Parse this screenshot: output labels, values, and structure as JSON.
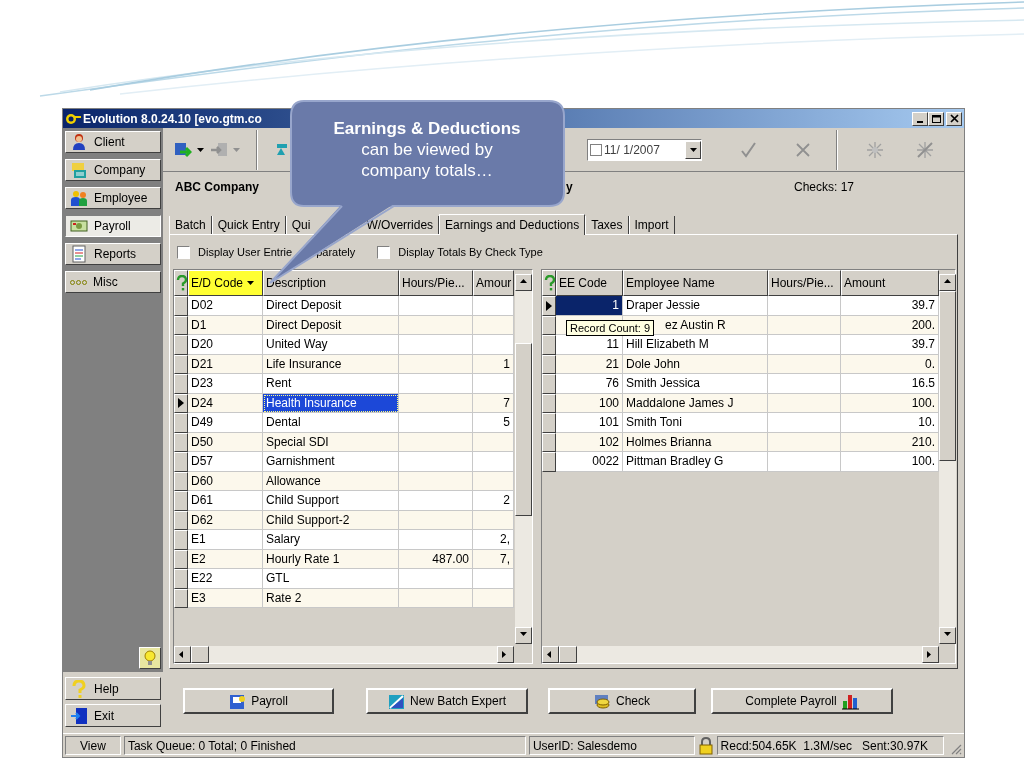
{
  "window": {
    "title": "Evolution 8.0.24.10 [evo.gtm.co"
  },
  "sidebar": {
    "items": [
      {
        "label": "Client",
        "selected": false
      },
      {
        "label": "Company",
        "selected": false
      },
      {
        "label": "Employee",
        "selected": false
      },
      {
        "label": "Payroll",
        "selected": true
      },
      {
        "label": "Reports",
        "selected": false
      },
      {
        "label": "Misc",
        "selected": false
      }
    ],
    "bottom_items": [
      {
        "label": "Help"
      },
      {
        "label": "Exit"
      }
    ]
  },
  "toolbar": {
    "date": "11/ 1/2007",
    "date_checked": false
  },
  "header": {
    "company": "ABC Company",
    "fragment": "y",
    "checks": "Checks: 17"
  },
  "tabs": [
    {
      "label_parts": [
        "Batch"
      ],
      "selected": false
    },
    {
      "label_parts": [
        "Quick Entry"
      ],
      "selected": false
    },
    {
      "label_parts": [
        "Qui",
        "W/Overrides"
      ],
      "selected": false
    },
    {
      "label_parts": [
        "Earnings and Deductions"
      ],
      "selected": true
    },
    {
      "label_parts": [
        "Taxes"
      ],
      "selected": false
    },
    {
      "label_parts": [
        "Import"
      ],
      "selected": false
    }
  ],
  "options": [
    {
      "label_parts": [
        "Display User Entrie",
        "parately"
      ],
      "checked": false
    },
    {
      "label_parts": [
        "Display Totals By Check Type"
      ],
      "checked": false
    }
  ],
  "left_table": {
    "columns": [
      {
        "label": "E/D Code",
        "sorted": true
      },
      {
        "label": "Description",
        "sorted": false
      },
      {
        "label": "Hours/Pie...",
        "sorted": false
      },
      {
        "label": "Amour",
        "sorted": false
      }
    ],
    "rows": [
      {
        "code": "D02",
        "description": "Direct Deposit",
        "selected": false
      },
      {
        "code": "D1",
        "description": "Direct Deposit",
        "selected": false
      },
      {
        "code": "D20",
        "description": "United Way",
        "selected": false
      },
      {
        "code": "D21",
        "description": "Life Insurance",
        "amount": "1",
        "selected": false
      },
      {
        "code": "D23",
        "description": "Rent",
        "selected": false
      },
      {
        "code": "D24",
        "description": "Health Insurance",
        "amount": "7",
        "selected": true
      },
      {
        "code": "D49",
        "description": "Dental",
        "amount": "5",
        "selected": false
      },
      {
        "code": "D50",
        "description": "Special SDI",
        "selected": false
      },
      {
        "code": "D57",
        "description": "Garnishment",
        "selected": false
      },
      {
        "code": "D60",
        "description": "Allowance",
        "selected": false
      },
      {
        "code": "D61",
        "description": "Child Support",
        "amount": "2",
        "selected": false
      },
      {
        "code": "D62",
        "description": "Child Support-2",
        "selected": false
      },
      {
        "code": "E1",
        "description": "Salary",
        "amount": "2,",
        "selected": false
      },
      {
        "code": "E2",
        "description": "Hourly Rate 1",
        "hours": "487.00",
        "amount": "7,",
        "selected": false
      },
      {
        "code": "E22",
        "description": "GTL",
        "selected": false
      },
      {
        "code": "E3",
        "description": "Rate 2",
        "selected": false
      }
    ]
  },
  "right_table": {
    "columns": [
      {
        "label": "EE Code"
      },
      {
        "label": "Employee Name"
      },
      {
        "label": "Hours/Pie..."
      },
      {
        "label": "Amount"
      }
    ],
    "rows": [
      {
        "code": "1",
        "name": "Draper Jessie",
        "amount": "39.7",
        "selected": true
      },
      {
        "name": "ez Austin R",
        "amount": "200.",
        "selected": false
      },
      {
        "code": "11",
        "name": "Hill Elizabeth M",
        "amount": "39.7",
        "selected": false
      },
      {
        "code": "21",
        "name": "Dole John",
        "amount": "0.",
        "selected": false
      },
      {
        "code": "76",
        "name": "Smith Jessica",
        "amount": "16.5",
        "selected": false
      },
      {
        "code": "100",
        "name": "Maddalone James J",
        "amount": "100.",
        "selected": false
      },
      {
        "code": "101",
        "name": "Smith Toni",
        "amount": "10.",
        "selected": false
      },
      {
        "code": "102",
        "name": "Holmes Brianna",
        "amount": "210.",
        "selected": false
      },
      {
        "code": "0022",
        "name": "Pittman Bradley G",
        "amount": "100.",
        "selected": false
      }
    ],
    "tooltip": "Record Count: 9"
  },
  "buttons": [
    {
      "label": "Payroll",
      "kind": "leading"
    },
    {
      "label": "New Batch Expert",
      "kind": "leading"
    },
    {
      "label": "Check",
      "kind": "leading"
    },
    {
      "label": "Complete Payroll",
      "kind": "trailing"
    }
  ],
  "status_bar": {
    "view": "View",
    "queue": "Task Queue: 0 Total; 0 Finished",
    "user": "UserID: Salesdemo",
    "traffic": "Recd:504.65K  1.3M/sec   Sent:30.97K"
  },
  "callout": {
    "lines": [
      "**Earnings & Deductions**",
      "can be viewed by",
      "company totals…"
    ]
  }
}
